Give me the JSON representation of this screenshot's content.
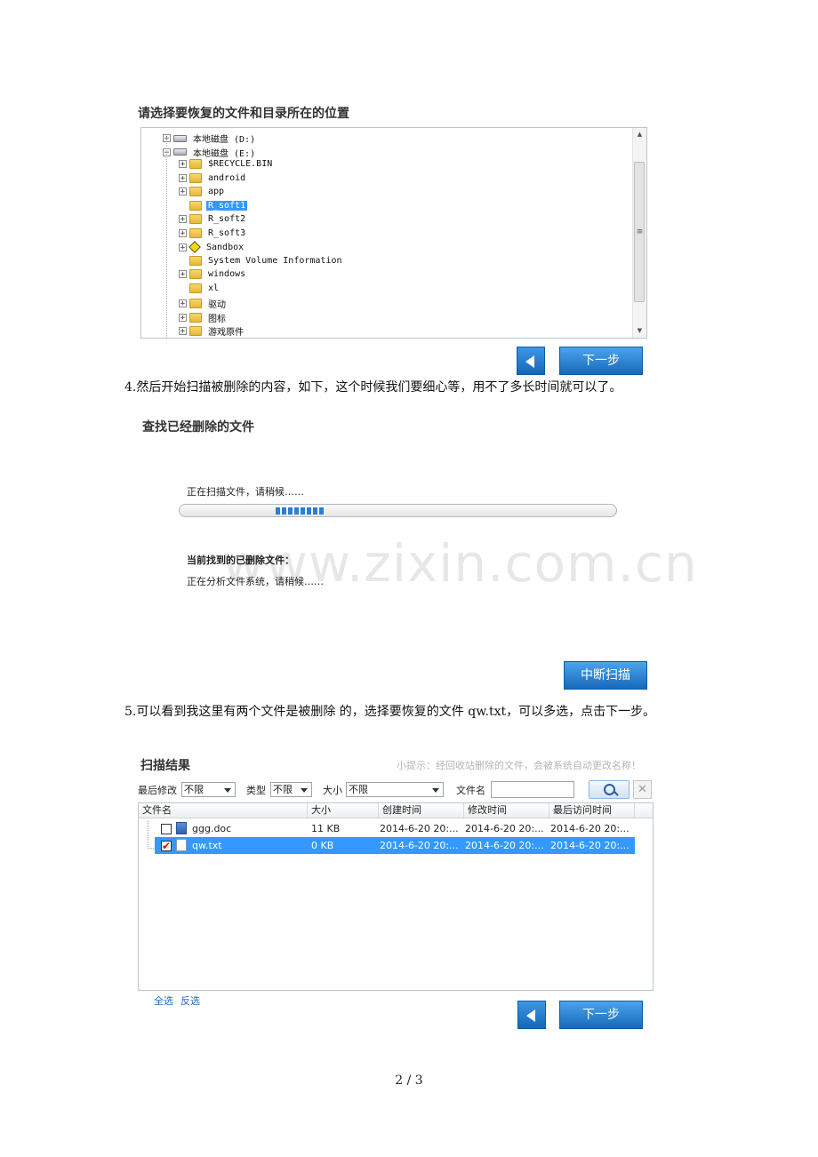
{
  "section1": {
    "title": "请选择要恢复的文件和目录所在的位置",
    "tree": [
      {
        "label": "本地磁盘 (D:)",
        "indent": 0,
        "icon": "drive-icon",
        "expander": "+"
      },
      {
        "label": "本地磁盘 (E:)",
        "indent": 0,
        "icon": "drive-icon",
        "expander": "-"
      },
      {
        "label": "$RECYCLE.BIN",
        "indent": 1,
        "icon": "folder-icon",
        "expander": "+"
      },
      {
        "label": "android",
        "indent": 1,
        "icon": "folder-icon",
        "expander": "+"
      },
      {
        "label": "app",
        "indent": 1,
        "icon": "folder-icon",
        "expander": "+"
      },
      {
        "label": "R_soft1",
        "indent": 1,
        "icon": "folder-icon",
        "expander": "",
        "selected": true
      },
      {
        "label": "R_soft2",
        "indent": 1,
        "icon": "folder-icon",
        "expander": "+"
      },
      {
        "label": "R_soft3",
        "indent": 1,
        "icon": "folder-icon",
        "expander": "+"
      },
      {
        "label": "Sandbox",
        "indent": 1,
        "icon": "sandbox-icon",
        "expander": "+"
      },
      {
        "label": "System Volume Information",
        "indent": 1,
        "icon": "folder-icon",
        "expander": ""
      },
      {
        "label": "windows",
        "indent": 1,
        "icon": "folder-icon",
        "expander": "+"
      },
      {
        "label": "xl",
        "indent": 1,
        "icon": "folder-icon",
        "expander": ""
      },
      {
        "label": "驱动",
        "indent": 1,
        "icon": "folder-icon",
        "expander": "+"
      },
      {
        "label": "图标",
        "indent": 1,
        "icon": "folder-icon",
        "expander": "+"
      },
      {
        "label": "游戏原件",
        "indent": 1,
        "icon": "folder-icon",
        "expander": "+"
      }
    ],
    "next_label": "下一步"
  },
  "para4": "4.然后开始扫描被删除的内容，如下，这个时候我们要细心等，用不了多长时间就可以了。",
  "section2": {
    "title": "查找已经删除的文件",
    "scanning": "正在扫描文件，请稍候……",
    "progress": 0.14,
    "found_label": "当前找到的已删除文件：",
    "analyzing": "正在分析文件系统，请稍候……",
    "stop_label": "中断扫描"
  },
  "watermark": "www.zixin.com.cn",
  "para5": "5.可以看到我这里有两个文件是被删除  的，选择要恢复的文件 qw.txt，可以多选，点击下一步。",
  "section3": {
    "title": "扫描结果",
    "hint": "小提示：经回收站删除的文件，会被系统自动更改名称！",
    "filters": {
      "modified_label": "最后修改",
      "modified_value": "不限",
      "type_label": "类型",
      "type_value": "不限",
      "size_label": "大小",
      "size_value": "不限",
      "filename_label": "文件名",
      "filename_value": ""
    },
    "columns": [
      "文件名",
      "大小",
      "创建时间",
      "修改时间",
      "最后访问时间"
    ],
    "rows": [
      {
        "name": "ggg.doc",
        "size": "11 KB",
        "created": "2014-6-20 20:...",
        "modified": "2014-6-20 20:...",
        "accessed": "2014-6-20 20:...",
        "checked": false,
        "icon": "doc-file-icon"
      },
      {
        "name": "qw.txt",
        "size": "0 KB",
        "created": "2014-6-20 20:...",
        "modified": "2014-6-20 20:...",
        "accessed": "2014-6-20 20:...",
        "checked": true,
        "icon": "txt-file-icon"
      }
    ],
    "select_all": "全选",
    "invert": "反选",
    "next_label": "下一步"
  },
  "page_number": "2 / 3"
}
